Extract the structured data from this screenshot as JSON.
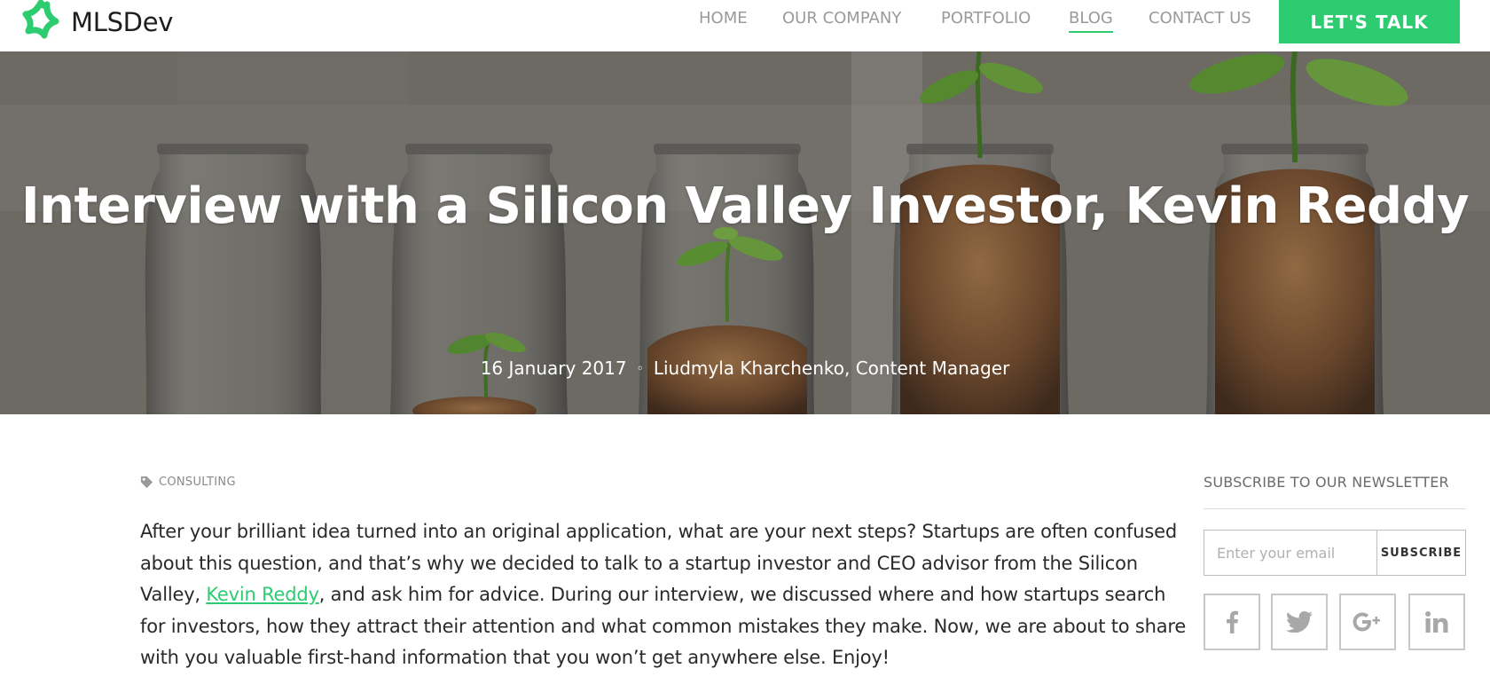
{
  "brand": {
    "name": "MLSDev",
    "accent_color": "#2ecc71"
  },
  "nav": {
    "items": [
      {
        "label": "HOME",
        "active": false
      },
      {
        "label": "OUR COMPANY",
        "active": false
      },
      {
        "label": "PORTFOLIO",
        "active": false
      },
      {
        "label": "BLOG",
        "active": true
      },
      {
        "label": "CONTACT US",
        "active": false
      }
    ],
    "cta_label": "LET'S TALK"
  },
  "hero": {
    "title": "Interview with a Silicon Valley Investor, Kevin Reddy",
    "date": "16 January 2017",
    "separator": "◦",
    "author": "Liudmyla Kharchenko, Content Manager"
  },
  "article": {
    "tag": "CONSULTING",
    "tag_icon": "tag-icon",
    "intro_before_link": "After your brilliant idea turned into an original application, what are your next steps? Startups are often confused about this question, and that’s why we decided to talk to a startup investor and CEO advisor from the Silicon Valley, ",
    "link_text": "Kevin Reddy",
    "intro_after_link": ", and ask him for advice. During our interview, we discussed where and how startups search for investors, how they attract their attention and what common mistakes they make. Now, we are about to share with you valuable first-hand information that you won’t get anywhere else. Enjoy!"
  },
  "sidebar": {
    "newsletter_heading": "SUBSCRIBE TO OUR NEWSLETTER",
    "email_placeholder": "Enter your email",
    "subscribe_label": "SUBSCRIBE",
    "social": [
      {
        "icon": "facebook-icon"
      },
      {
        "icon": "twitter-icon"
      },
      {
        "icon": "google-plus-icon"
      },
      {
        "icon": "linkedin-icon"
      }
    ]
  }
}
